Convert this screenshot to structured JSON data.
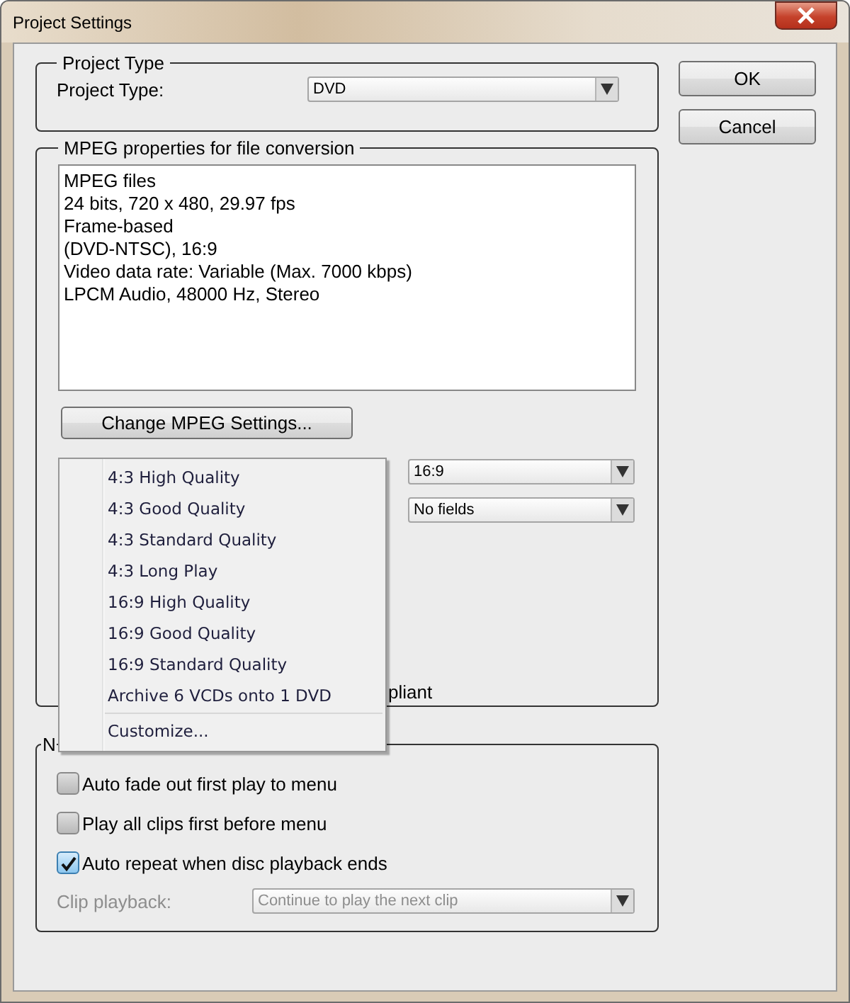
{
  "window": {
    "title": "Project Settings"
  },
  "project_type_group": {
    "title": "Project Type",
    "label": "Project Type:",
    "value": "DVD"
  },
  "buttons": [
    {
      "label": "OK"
    },
    {
      "label": "Cancel"
    }
  ],
  "mpeg_group": {
    "title": "MPEG properties for file conversion",
    "info_lines": [
      "MPEG files",
      "24 bits, 720 x 480, 29.97 fps",
      "Frame-based",
      "(DVD-NTSC), 16:9",
      "Video data rate: Variable (Max. 7000 kbps)",
      "LPCM Audio, 48000 Hz, Stereo"
    ],
    "change_button": "Change MPEG Settings...",
    "dropdowns": [
      {
        "value": "16:9"
      },
      {
        "value": "No fields"
      }
    ],
    "checkbox_label_fragment": "pliant"
  },
  "menu": {
    "items": [
      {
        "label": "4:3 High Quality"
      },
      {
        "label": "4:3 Good Quality"
      },
      {
        "label": "4:3 Standard Quality"
      },
      {
        "label": "4:3 Long Play"
      },
      {
        "label": "16:9 High Quality"
      },
      {
        "label": "16:9 Good Quality"
      },
      {
        "label": "16:9 Standard Quality"
      },
      {
        "label": "Archive 6 VCDs onto 1 DVD"
      }
    ],
    "footer_item": "Customize..."
  },
  "navigation_group": {
    "title_fragment": "N",
    "checkboxes": [
      {
        "label": "Auto fade out first play to menu",
        "checked": false
      },
      {
        "label": "Play all clips first before menu",
        "checked": false
      },
      {
        "label": "Auto repeat when disc playback ends",
        "checked": true
      }
    ],
    "clip_playback": {
      "label": "Clip playback:",
      "value": "Continue to play the next clip",
      "disabled": true
    }
  }
}
